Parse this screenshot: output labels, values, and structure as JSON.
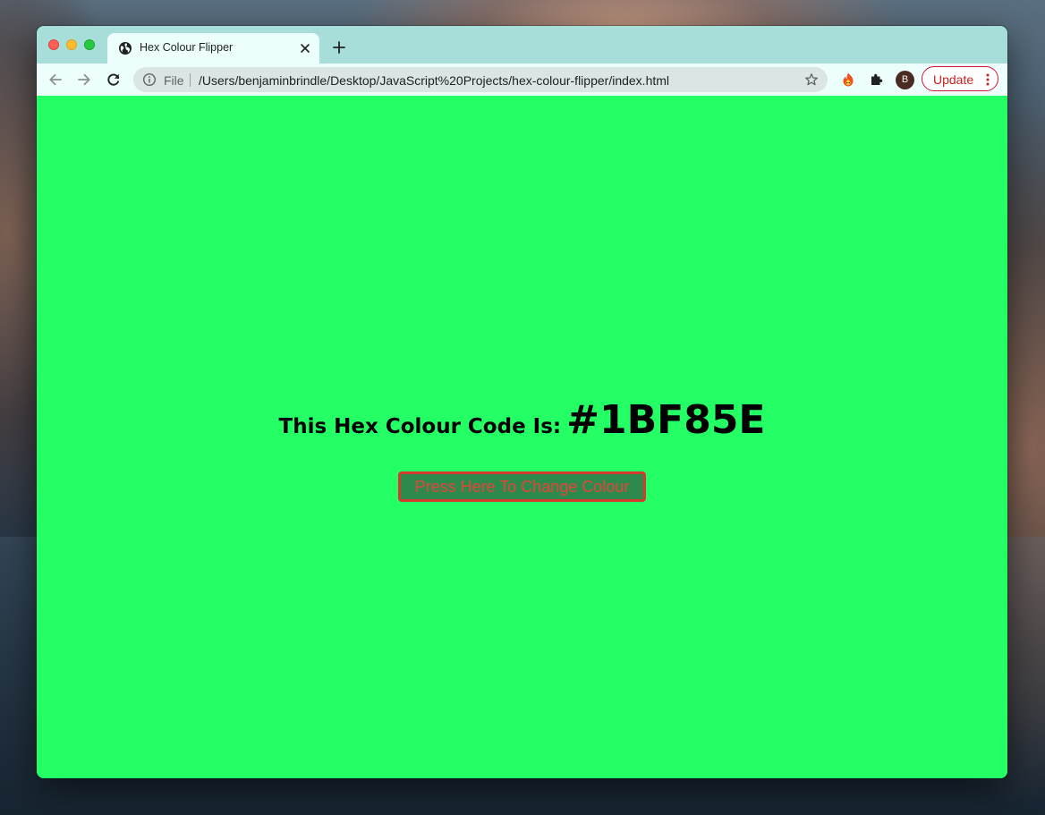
{
  "browser": {
    "tab": {
      "title": "Hex Colour Flipper",
      "favicon": "globe-icon",
      "close_icon": "close-icon"
    },
    "new_tab_icon": "plus-icon",
    "nav": {
      "back_icon": "arrow-left-icon",
      "forward_icon": "arrow-right-icon",
      "reload_icon": "reload-icon"
    },
    "address_bar": {
      "scheme_label": "File",
      "url": "/Users/benjaminbrindle/Desktop/JavaScript%20Projects/hex-colour-flipper/index.html",
      "info_icon": "info-icon",
      "bookmark_icon": "star-icon"
    },
    "extensions": [
      "fire-extension-icon",
      "puzzle-piece-icon"
    ],
    "profile": {
      "initial": "B"
    },
    "update_button": {
      "label": "Update",
      "menu_icon": "vertical-dots-icon"
    }
  },
  "page": {
    "background_color": "#24ff66",
    "label": "This Hex Colour Code Is:",
    "hex_value": "#1BF85E",
    "button_label": "Press Here To Change Colour"
  },
  "colors": {
    "tab_strip": "#a8ded9",
    "toolbar": "#ecfffd",
    "update_accent": "#d4153a",
    "button_border": "#d63a2c",
    "button_text": "#e4453a"
  }
}
